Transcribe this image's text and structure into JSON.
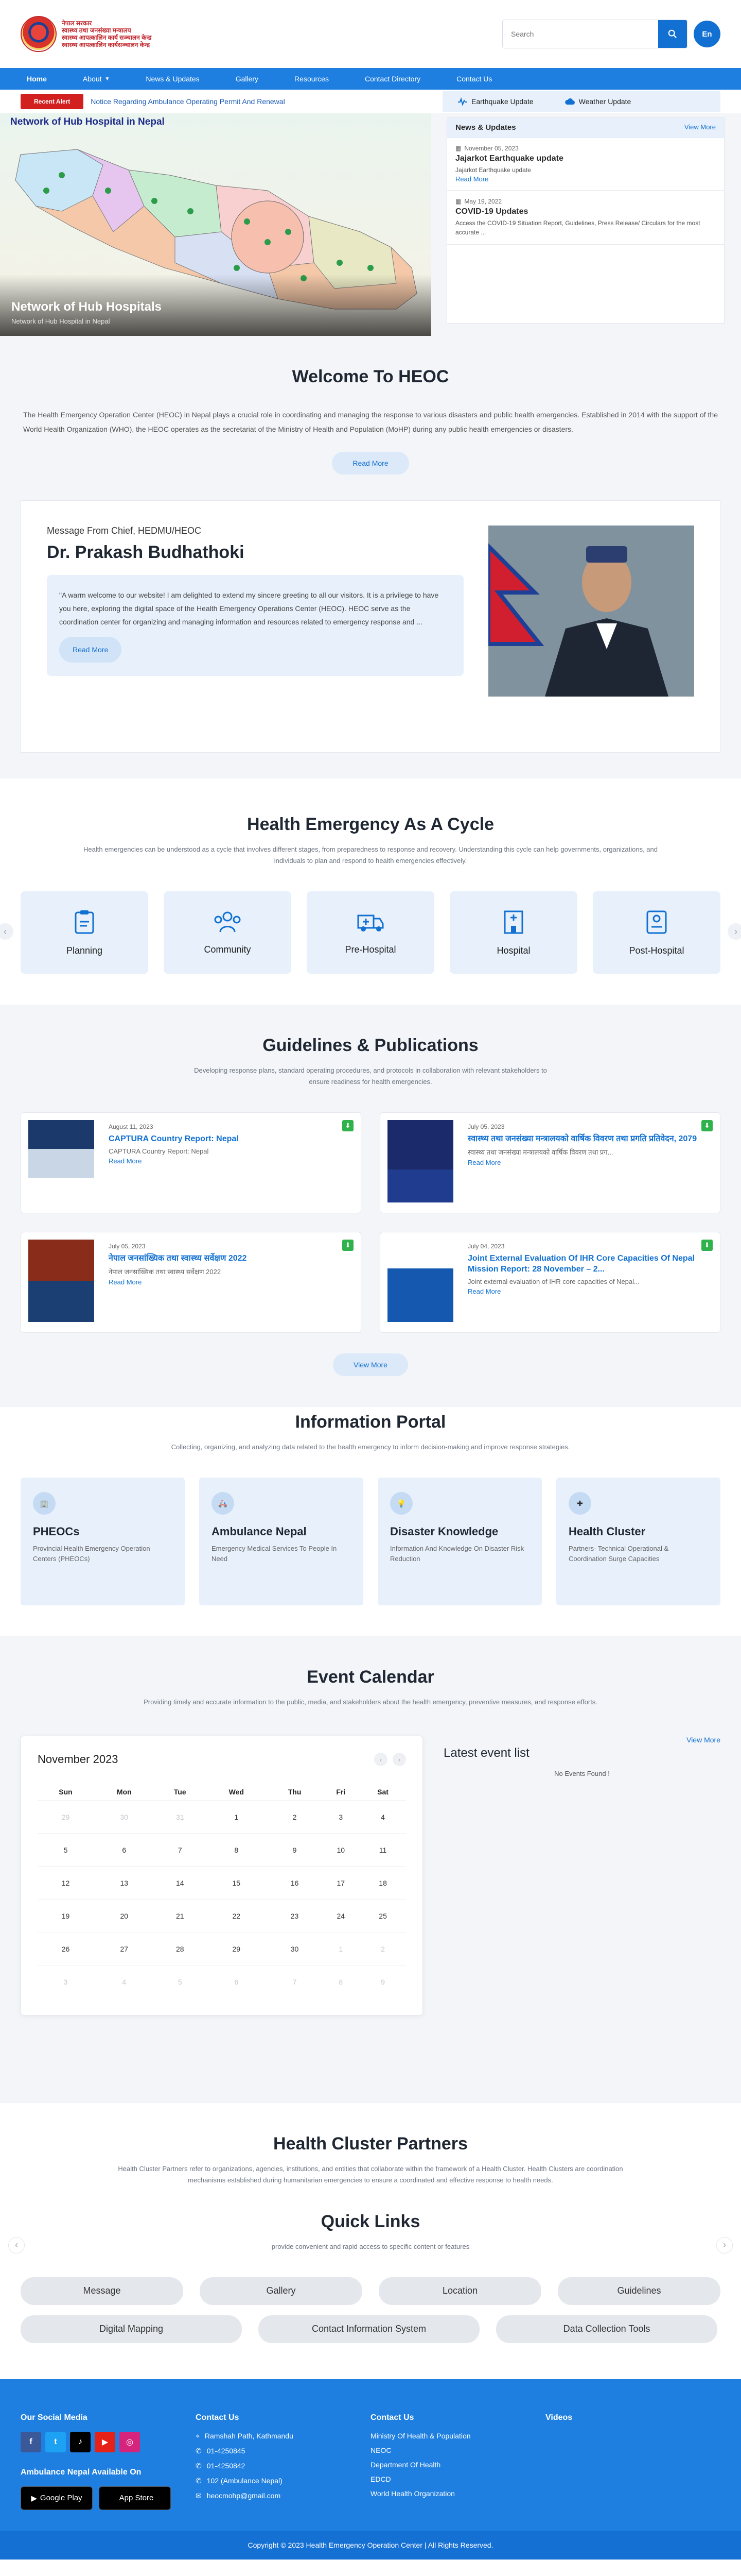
{
  "header": {
    "logo_lines": [
      "नेपाल सरकार",
      "स्वास्थ्य तथा जनसंख्या मन्त्रालय",
      "स्वास्थ्य आपत्कालिन कार्य सञ्चालन केन्द्र",
      "स्वास्थ्य आपत्कालिन कार्यसञ्चालन केन्द्र"
    ],
    "search_placeholder": "Search",
    "lang": "En"
  },
  "nav": [
    "Home",
    "About",
    "News & Updates",
    "Gallery",
    "Resources",
    "Contact Directory",
    "Contact Us"
  ],
  "alert": {
    "badge": "Recent Alert",
    "text": "Notice Regarding Ambulance Operating Permit And Renewal",
    "earthquake": "Earthquake Update",
    "weather": "Weather Update"
  },
  "hero": {
    "map_title": "Network of Hub Hospital in Nepal",
    "caption_title": "Network of Hub Hospitals",
    "caption_sub": "Network of Hub Hospital in Nepal"
  },
  "news": {
    "title": "News & Updates",
    "view_more": "View More",
    "items": [
      {
        "date": "November 05, 2023",
        "title": "Jajarkot Earthquake update",
        "desc": "Jajarkot Earthquake update",
        "more": "Read More"
      },
      {
        "date": "May 19, 2022",
        "title": "COVID-19 Updates",
        "desc": "Access the COVID-19 Situation Report, Guidelines, Press Release/ Circulars for the most accurate ...",
        "more": ""
      }
    ]
  },
  "welcome": {
    "title": "Welcome To HEOC",
    "text": "The Health Emergency Operation Center (HEOC) in Nepal plays a crucial role in coordinating and managing the response to various disasters and public health emergencies. Established in 2014 with the support of the World Health Organization (WHO), the HEOC operates as the secretariat of the Ministry of Health and Population (MoHP) during any public health emergencies or disasters.",
    "button": "Read More"
  },
  "chief": {
    "label": "Message From Chief, HEDMU/HEOC",
    "name": "Dr. Prakash Budhathoki",
    "quote": "\"A warm welcome to our website! I am delighted to extend my sincere greeting to all our visitors. It is a privilege to have you here, exploring the digital space of the Health Emergency Operations Center (HEOC). HEOC serve as the coordination center for organizing and managing information and resources related to emergency response and ...",
    "button": "Read More"
  },
  "cycle": {
    "title": "Health Emergency As A Cycle",
    "sub": "Health emergencies can be understood as a cycle that involves different stages, from preparedness to response and recovery. Understanding this cycle can help governments, organizations, and individuals to plan and respond to health emergencies effectively.",
    "items": [
      "Planning",
      "Community",
      "Pre-Hospital",
      "Hospital",
      "Post-Hospital"
    ]
  },
  "guidelines": {
    "title": "Guidelines & Publications",
    "sub": "Developing response plans, standard operating procedures, and protocols in collaboration with relevant stakeholders to ensure readiness for health emergencies.",
    "view_more": "View More",
    "items": [
      {
        "date": "August 11, 2023",
        "title": "CAPTURA Country Report: Nepal",
        "desc": "CAPTURA Country Report: Nepal",
        "more": "Read More"
      },
      {
        "date": "July 05, 2023",
        "title": "स्वास्थ्य तथा जनसंख्या मन्त्रालयको वार्षिक विवरण तथा प्रगति प्रतिवेदन, 2079",
        "desc": "स्वास्थ्य तथा जनसंख्या मन्त्रालयको वार्षिक विवरण तथा प्रग...",
        "more": "Read More"
      },
      {
        "date": "July 05, 2023",
        "title": "नेपाल जनसांख्यिक तथा स्वास्थ्य सर्वेक्षण 2022",
        "desc": "नेपाल जनसांख्यिक तथा स्वास्थ्य सर्वेक्षण 2022",
        "more": "Read More"
      },
      {
        "date": "July 04, 2023",
        "title": "Joint External Evaluation Of IHR Core Capacities Of Nepal Mission Report: 28 November – 2...",
        "desc": "Joint external evaluation of IHR core capacities of Nepal...",
        "more": "Read More"
      }
    ]
  },
  "portal": {
    "title": "Information Portal",
    "sub": "Collecting, organizing, and analyzing data related to the health emergency to inform decision-making and improve response strategies.",
    "items": [
      {
        "title": "PHEOCs",
        "desc": "Provincial Health Emergency Operation Centers (PHEOCs)"
      },
      {
        "title": "Ambulance Nepal",
        "desc": "Emergency Medical Services To People In Need"
      },
      {
        "title": "Disaster Knowledge",
        "desc": "Information And Knowledge On Disaster Risk Reduction"
      },
      {
        "title": "Health Cluster",
        "desc": "Partners- Technical Operational & Coordination Surge Capacities"
      }
    ]
  },
  "calendar": {
    "title": "Event Calendar",
    "sub": "Providing timely and accurate information to the public, media, and stakeholders about the health emergency, preventive measures, and response efforts.",
    "month": "November 2023",
    "days": [
      "Sun",
      "Mon",
      "Tue",
      "Wed",
      "Thu",
      "Fri",
      "Sat"
    ],
    "weeks": [
      [
        "29",
        "30",
        "31",
        "1",
        "2",
        "3",
        "4"
      ],
      [
        "5",
        "6",
        "7",
        "8",
        "9",
        "10",
        "11"
      ],
      [
        "12",
        "13",
        "14",
        "15",
        "16",
        "17",
        "18"
      ],
      [
        "19",
        "20",
        "21",
        "22",
        "23",
        "24",
        "25"
      ],
      [
        "26",
        "27",
        "28",
        "29",
        "30",
        "1",
        "2"
      ],
      [
        "3",
        "4",
        "5",
        "6",
        "7",
        "8",
        "9"
      ]
    ],
    "events_title": "Latest event list",
    "events_none": "No Events Found !",
    "view_more": "View More"
  },
  "partners": {
    "title": "Health Cluster Partners",
    "sub": "Health Cluster Partners refer to organizations, agencies, institutions, and entities that collaborate within the framework of a Health Cluster. Health Clusters are coordination mechanisms established during humanitarian emergencies to ensure a coordinated and effective response to health needs."
  },
  "quick": {
    "title": "Quick Links",
    "sub": "provide convenient and rapid access to specific content or features",
    "row1": [
      "Message",
      "Gallery",
      "Location",
      "Guidelines"
    ],
    "row2": [
      "Digital Mapping",
      "Contact Information System",
      "Data Collection Tools"
    ]
  },
  "footer": {
    "social_title": "Our Social Media",
    "ambulance_title": "Ambulance Nepal Available On",
    "google": "Google Play",
    "apple": "App Store",
    "contact_title": "Contact Us",
    "contacts": [
      "Ramshah Path, Kathmandu",
      "01-4250845",
      "01-4250842",
      "102 (Ambulance Nepal)",
      "heocmohp@gmail.com"
    ],
    "contact2_title": "Contact Us",
    "links": [
      "Ministry Of Health & Population",
      "NEOC",
      "Department Of Health",
      "EDCD",
      "World Health Organization"
    ],
    "videos_title": "Videos",
    "copyright": "Copyright © 2023 Health Emergency Operation Center  |  All Rights Reserved."
  }
}
